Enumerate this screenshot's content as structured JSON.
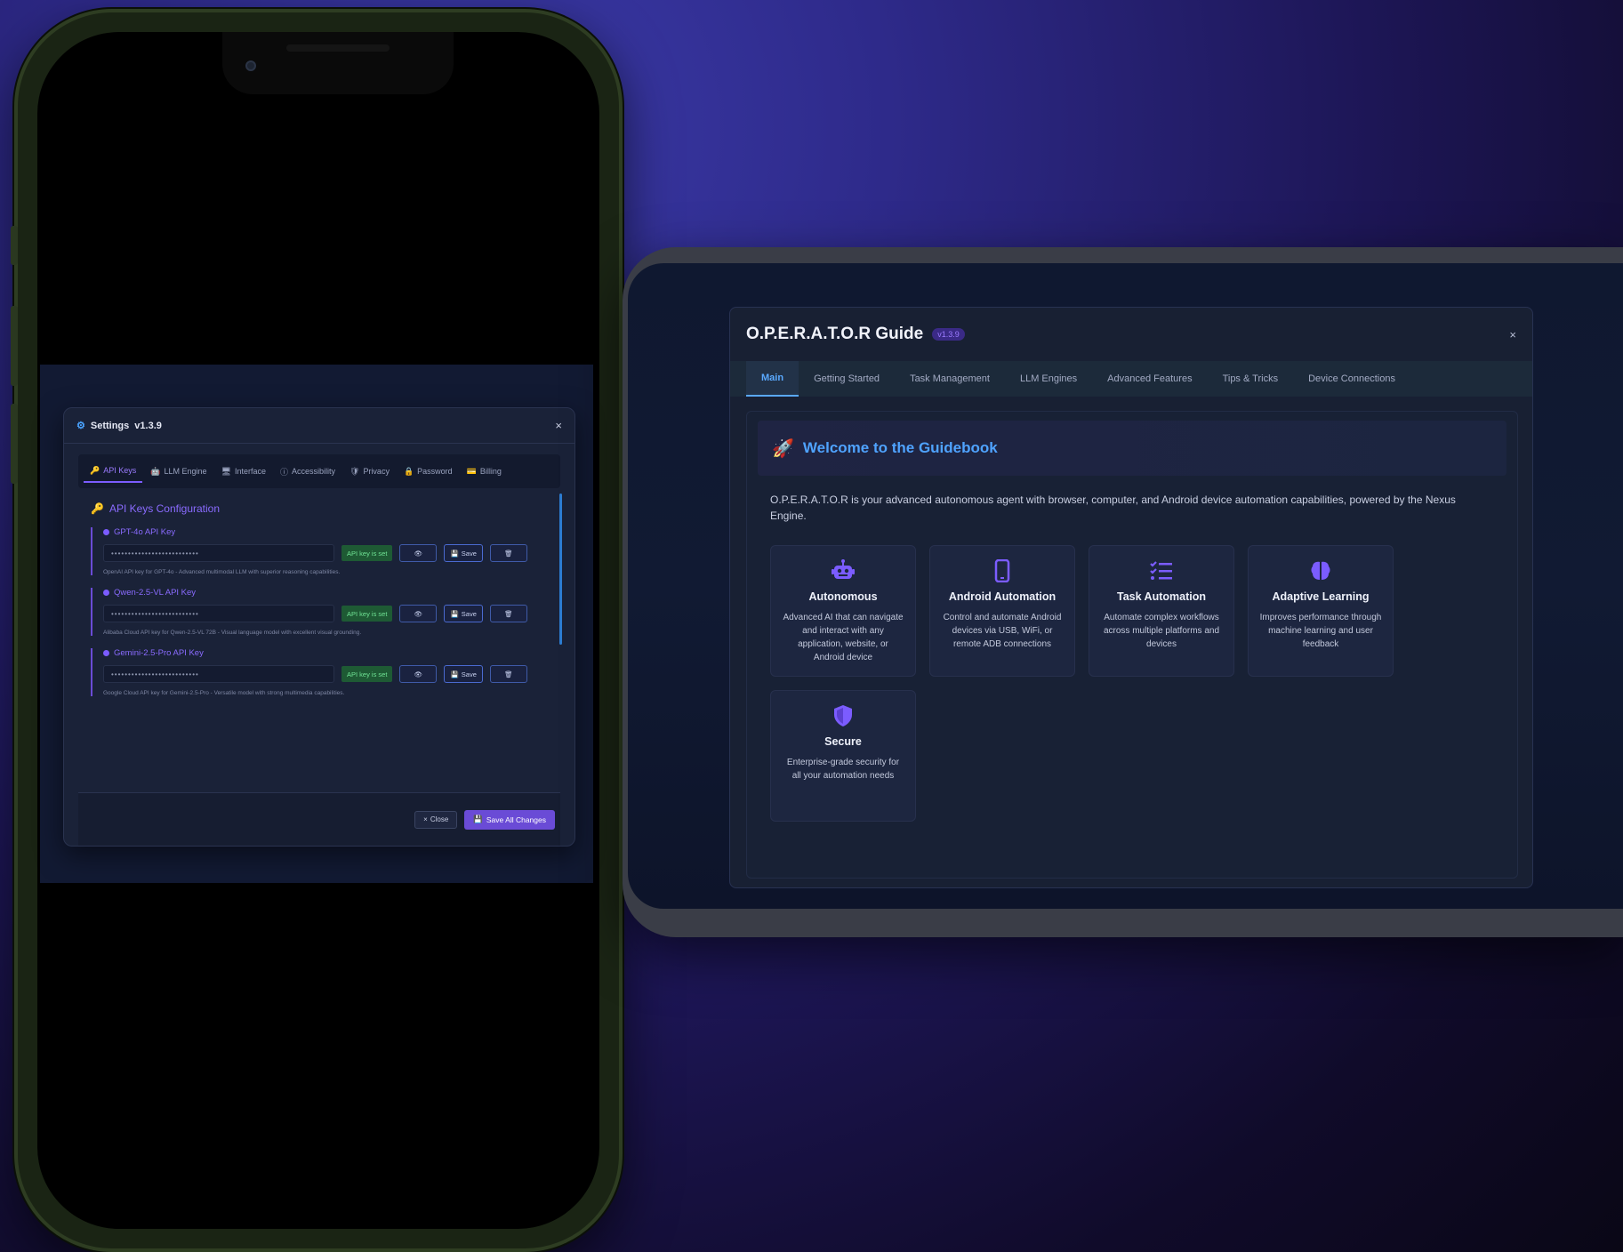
{
  "phone": {
    "settings": {
      "title": "Settings",
      "version": "v1.3.9",
      "close_glyph": "×",
      "tabs": [
        {
          "label": "API Keys",
          "icon": "key-icon",
          "active": true
        },
        {
          "label": "LLM Engine",
          "icon": "robot-icon",
          "active": false
        },
        {
          "label": "Interface",
          "icon": "monitor-icon",
          "active": false
        },
        {
          "label": "Accessibility",
          "icon": "accessibility-icon",
          "active": false
        },
        {
          "label": "Privacy",
          "icon": "shield-icon",
          "active": false
        },
        {
          "label": "Password",
          "icon": "lock-icon",
          "active": false
        },
        {
          "label": "Billing",
          "icon": "billing-icon",
          "active": false
        }
      ],
      "section_title": "API Keys Configuration",
      "keys": [
        {
          "label": "GPT-4o API Key",
          "masked": "••••••••••••••••••••••••••",
          "status": "API key is set",
          "view_glyph": "👁",
          "save_label": "Save",
          "delete_glyph": "🗑",
          "description": "OpenAI API key for GPT-4o - Advanced multimodal LLM with superior reasoning capabilities."
        },
        {
          "label": "Qwen-2.5-VL API Key",
          "masked": "••••••••••••••••••••••••••",
          "status": "API key is set",
          "view_glyph": "👁",
          "save_label": "Save",
          "delete_glyph": "🗑",
          "description": "Alibaba Cloud API key for Qwen-2.5-VL 72B - Visual language model with excellent visual grounding."
        },
        {
          "label": "Gemini-2.5-Pro API Key",
          "masked": "••••••••••••••••••••••••••",
          "status": "API key is set",
          "view_glyph": "👁",
          "save_label": "Save",
          "delete_glyph": "🗑",
          "description": "Google Cloud API key for Gemini-2.5-Pro - Versatile model with strong multimedia capabilities."
        }
      ],
      "footer": {
        "close_label": "Close",
        "save_all_label": "Save All Changes"
      }
    }
  },
  "tablet": {
    "guide": {
      "title": "O.P.E.R.A.T.O.R Guide",
      "version": "v1.3.9",
      "close_glyph": "×",
      "tabs": [
        {
          "label": "Main",
          "active": true
        },
        {
          "label": "Getting Started",
          "active": false
        },
        {
          "label": "Task Management",
          "active": false
        },
        {
          "label": "LLM Engines",
          "active": false
        },
        {
          "label": "Advanced Features",
          "active": false
        },
        {
          "label": "Tips & Tricks",
          "active": false
        },
        {
          "label": "Device Connections",
          "active": false
        }
      ],
      "welcome_title": "Welcome to the Guidebook",
      "intro": "O.P.E.R.A.T.O.R is your advanced autonomous agent with browser, computer, and Android device automation capabilities, powered by the Nexus Engine.",
      "features": [
        {
          "icon": "robot-icon",
          "title": "Autonomous",
          "description": "Advanced AI that can navigate and interact with any application, website, or Android device"
        },
        {
          "icon": "mobile-phone-icon",
          "title": "Android Automation",
          "description": "Control and automate Android devices via USB, WiFi, or remote ADB connections"
        },
        {
          "icon": "task-list-icon",
          "title": "Task Automation",
          "description": "Automate complex workflows across multiple platforms and devices"
        },
        {
          "icon": "brain-icon",
          "title": "Adaptive Learning",
          "description": "Improves performance through machine learning and user feedback"
        },
        {
          "icon": "shield-icon",
          "title": "Secure",
          "description": "Enterprise-grade security for all your automation needs"
        }
      ]
    }
  },
  "colors": {
    "accent_purple": "#7b5cff",
    "accent_blue": "#4fa3ff",
    "status_green": "#6fe394"
  }
}
